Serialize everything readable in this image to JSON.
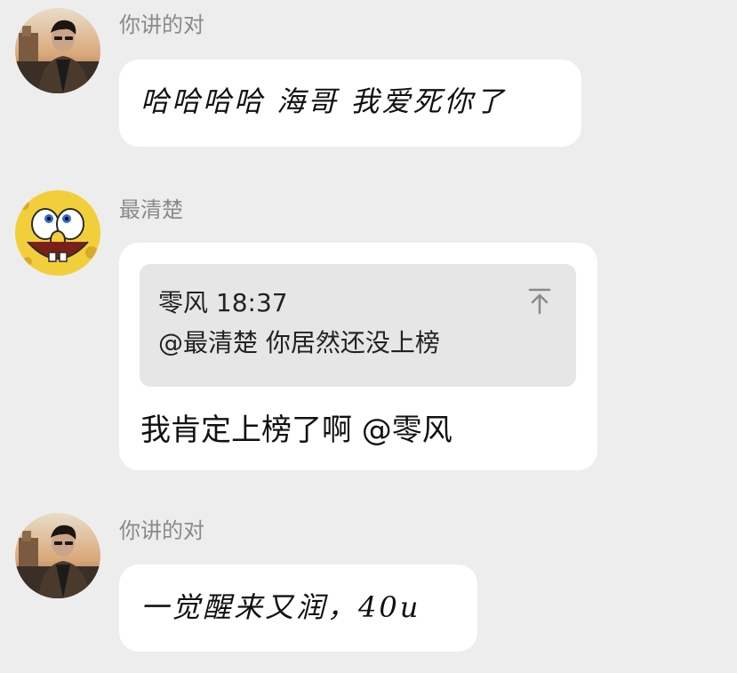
{
  "messages": [
    {
      "sender": "你讲的对",
      "avatar_icon": "person-photo-avatar",
      "text": "哈哈哈哈 海哥 我爱死你了"
    },
    {
      "sender": "最清楚",
      "avatar_icon": "cartoon-face-avatar",
      "quote": {
        "author": "零风",
        "time": "18:37",
        "text": "@最清楚 你居然还没上榜",
        "icon": "jump-to-original-arrow-icon"
      },
      "text": "我肯定上榜了啊 @零风"
    },
    {
      "sender": "你讲的对",
      "avatar_icon": "person-photo-avatar",
      "text": "一觉醒来又润，40u"
    }
  ],
  "colors": {
    "background": "#ededed",
    "bubble": "#ffffff",
    "quote_background": "#e6e6e6",
    "sender_name": "#8a8a8a",
    "text": "#111111"
  }
}
